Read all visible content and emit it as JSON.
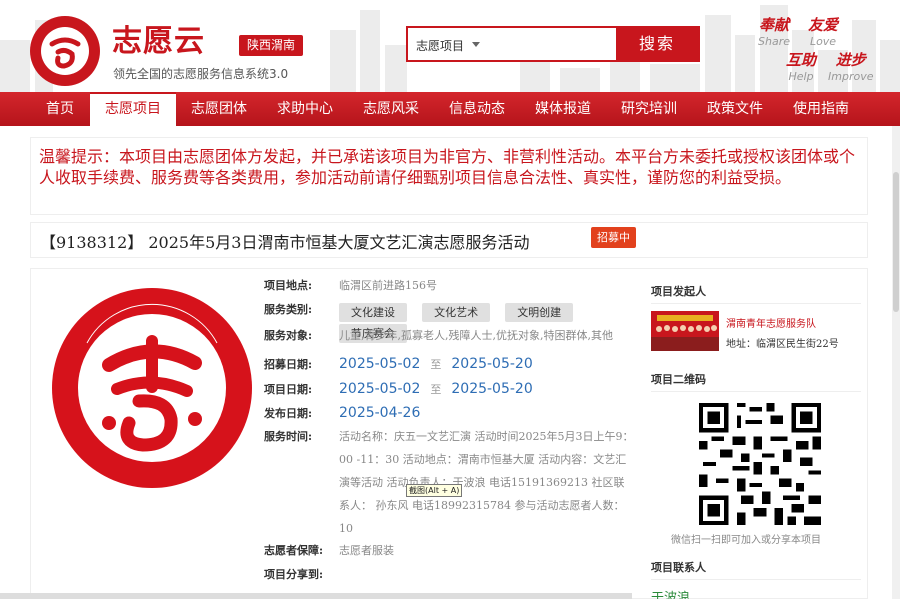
{
  "header": {
    "brand": "志愿云",
    "region": "陕西渭南",
    "slogan": "领先全国的志愿服务信息系统3.0",
    "search_select": "志愿项目",
    "search_button": "搜索",
    "mottos": [
      {
        "cn": "奉献",
        "en": "Share"
      },
      {
        "cn": "友爱",
        "en": "Love"
      },
      {
        "cn": "互助",
        "en": "Help"
      },
      {
        "cn": "进步",
        "en": "Improve"
      }
    ]
  },
  "nav": [
    "首页",
    "志愿项目",
    "志愿团体",
    "求助中心",
    "志愿风采",
    "信息动态",
    "媒体报道",
    "研究培训",
    "政策文件",
    "使用指南"
  ],
  "notice": "温馨提示：本项目由志愿团体方发起，并已承诺该项目为非官方、非营利性活动。本平台方未委托或授权该团体或个人收取手续费、服务费等各类费用，参加活动前请仔细甄别项目信息合法性、真实性，谨防您的利益受损。",
  "project": {
    "id": "【9138312】",
    "title": "2025年5月3日渭南市恒基大厦文艺汇演志愿服务活动",
    "status": "招募中"
  },
  "details": {
    "location_label": "项目地点:",
    "location": "临渭区前进路156号",
    "service_type_label": "服务类别:",
    "service_types": [
      "文化建设",
      "文化艺术",
      "文明创建",
      "节庆赛会"
    ],
    "target_label": "服务对象:",
    "target": "儿童,青少年,孤寡老人,残障人士,优抚对象,特困群体,其他",
    "recruit_label": "招募日期:",
    "recruit_start": "2025-05-02",
    "recruit_end": "2025-05-20",
    "project_date_label": "项目日期:",
    "project_start": "2025-05-02",
    "project_end": "2025-05-20",
    "publish_label": "发布日期:",
    "publish_date": "2025-04-26",
    "to_word": "至",
    "service_time_label": "服务时间:",
    "service_time": "活动名称：庆五一文艺汇演 活动时间2025年5月3日上午9：00 -11：30 活动地点：渭南市恒基大厦 活动内容：文艺汇演等活动 活动负责人：于波浪 电话15191369213 社区联系人： 孙东风 电话18992315784 参与活动志愿者人数：10",
    "protection_label": "志愿者保障:",
    "protection": "志愿者服装",
    "share_label": "项目分享到:"
  },
  "side": {
    "initiator_heading": "项目发起人",
    "org_name": "渭南青年志愿服务队",
    "org_addr": "地址：临渭区民生街22号",
    "qr_heading": "项目二维码",
    "qr_caption": "微信扫一扫即可加入或分享本项目",
    "contact_heading": "项目联系人",
    "contact_name": "于波浪"
  },
  "tooltip": "截图(Alt + A)",
  "colors": {
    "brand_red": "#c8161d",
    "date_blue": "#2e6db4",
    "badge_orange": "#e2411d"
  }
}
